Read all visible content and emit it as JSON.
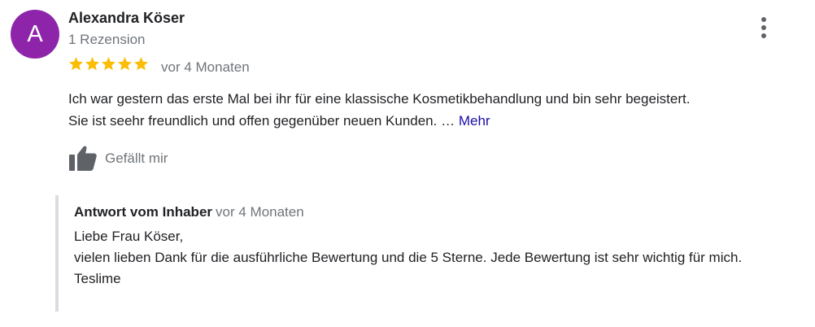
{
  "colors": {
    "avatar_bg": "#8e24aa",
    "star": "#fbbc04",
    "link": "#1a0dab",
    "secondary_text": "#70757a",
    "icon_gray": "#5f6368"
  },
  "review": {
    "avatar_letter": "A",
    "reviewer_name": "Alexandra Köser",
    "review_count": "1 Rezension",
    "rating": 5,
    "rating_max": 5,
    "time": "vor 4 Monaten",
    "text_line1": "Ich war gestern das erste Mal bei ihr für eine klassische Kosmetikbehandlung und bin sehr begeistert.",
    "text_line2": "Sie ist seehr freundlich und offen gegenüber neuen Kunden. …",
    "more_label": "Mehr",
    "like_label": "Gefällt mir",
    "icons": {
      "menu": "more-vert-icon",
      "star": "star-icon",
      "like": "thumb-up-icon"
    }
  },
  "owner_reply": {
    "title": "Antwort vom Inhaber",
    "time": "vor 4 Monaten",
    "line1": "Liebe Frau Köser,",
    "line2": "vielen lieben Dank für die ausführliche Bewertung und die 5 Sterne. Jede Bewertung ist sehr wichtig für mich.",
    "line3": "Teslime"
  }
}
